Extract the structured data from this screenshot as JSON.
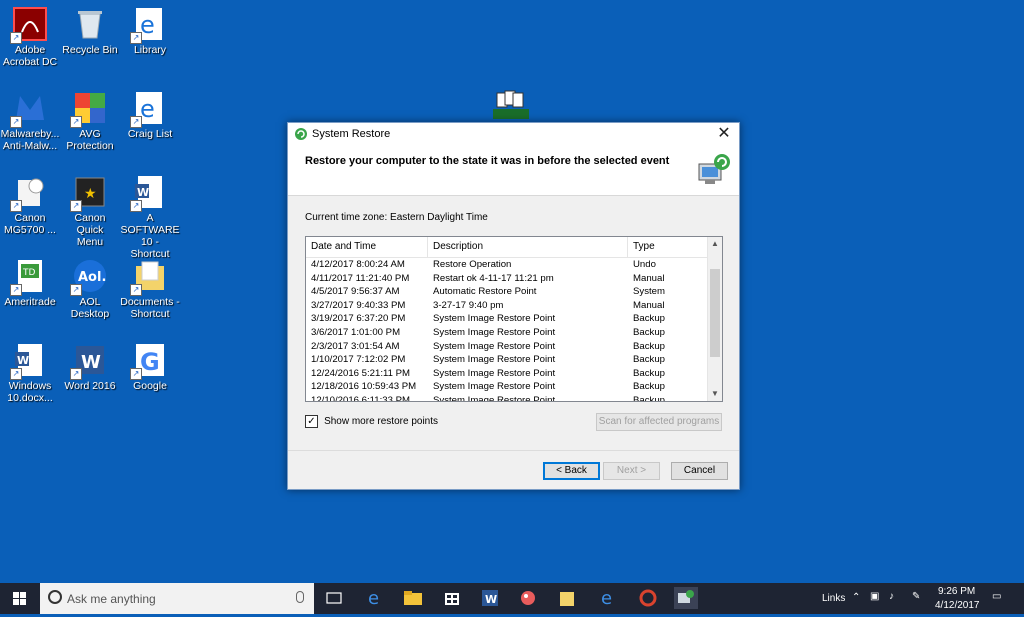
{
  "desktop": {
    "icons": [
      {
        "label": "Adobe\nAcrobat DC",
        "icon": "adobe-acrobat-icon"
      },
      {
        "label": "Recycle Bin",
        "icon": "recycle-bin-icon"
      },
      {
        "label": "Library",
        "icon": "internet-explorer-icon"
      },
      {
        "label": "Malwareby...\nAnti-Malw...",
        "icon": "malwarebytes-icon"
      },
      {
        "label": "AVG\nProtection",
        "icon": "avg-icon"
      },
      {
        "label": "Craig List",
        "icon": "internet-explorer-icon"
      },
      {
        "label": "Canon\nMG5700 ...",
        "icon": "canon-printer-icon"
      },
      {
        "label": "Canon Quick\nMenu",
        "icon": "canon-quick-menu-icon"
      },
      {
        "label": "A SOFTWARE\n10 - Shortcut",
        "icon": "word-doc-icon"
      },
      {
        "label": "Ameritrade",
        "icon": "td-ameritrade-icon"
      },
      {
        "label": "AOL Desktop",
        "icon": "aol-icon"
      },
      {
        "label": "Documents -\nShortcut",
        "icon": "documents-folder-icon"
      },
      {
        "label": "Windows\n10.docx...",
        "icon": "word-doc-icon"
      },
      {
        "label": "Word 2016",
        "icon": "word-app-icon"
      },
      {
        "label": "Google",
        "icon": "google-icon"
      }
    ]
  },
  "dialog": {
    "title": "System Restore",
    "header": "Restore your computer to the state it was in before the selected event",
    "timezone": "Current time zone: Eastern Daylight Time",
    "columns": [
      "Date and Time",
      "Description",
      "Type"
    ],
    "rows": [
      [
        "4/12/2017 8:00:24 AM",
        "Restore Operation",
        "Undo"
      ],
      [
        "4/11/2017 11:21:40 PM",
        "Restart ok 4-11-17 11:21 pm",
        "Manual"
      ],
      [
        "4/5/2017 9:56:37 AM",
        "Automatic Restore Point",
        "System"
      ],
      [
        "3/27/2017 9:40:33 PM",
        "3-27-17  9:40 pm",
        "Manual"
      ],
      [
        "3/19/2017 6:37:20 PM",
        "System Image Restore Point",
        "Backup"
      ],
      [
        "3/6/2017 1:01:00 PM",
        "System Image Restore Point",
        "Backup"
      ],
      [
        "2/3/2017 3:01:54 AM",
        "System Image Restore Point",
        "Backup"
      ],
      [
        "1/10/2017 7:12:02 PM",
        "System Image Restore Point",
        "Backup"
      ],
      [
        "12/24/2016 5:21:11 PM",
        "System Image Restore Point",
        "Backup"
      ],
      [
        "12/18/2016 10:59:43 PM",
        "System Image Restore Point",
        "Backup"
      ],
      [
        "12/10/2016 6:11:33 PM",
        "System Image Restore Point",
        "Backup"
      ]
    ],
    "show_more_label": "Show more restore points",
    "show_more_checked": "✓",
    "scan_label": "Scan for affected programs",
    "back_label": "< Back",
    "next_label": "Next >",
    "cancel_label": "Cancel",
    "close_glyph": "✕"
  },
  "taskbar": {
    "search_placeholder": "Ask me anything",
    "links_label": "Links",
    "clock_time": "9:26 PM",
    "clock_date": "4/12/2017"
  },
  "colors": {
    "desktop": "#0a5fb8",
    "taskbar": "#1e2433",
    "accent": "#0078d7"
  }
}
